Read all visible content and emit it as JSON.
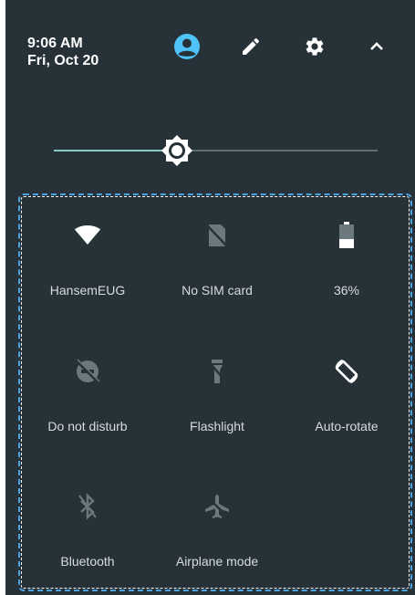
{
  "status": {
    "time": "9:06 AM",
    "date": "Fri, Oct 20"
  },
  "header_icons": [
    "account-icon",
    "edit-icon",
    "settings-icon",
    "collapse-icon"
  ],
  "colors": {
    "panel_bg": "#263238",
    "accent": "#80cbc4",
    "account_icon": "#4fc3f7",
    "active_icon": "#ffffff",
    "inactive_icon": "#6b787e",
    "selection_outline": "#4aa3df"
  },
  "brightness": {
    "level": 0.37
  },
  "tiles": [
    {
      "label": "HansemEUG",
      "icon": "wifi-icon",
      "active": true
    },
    {
      "label": "No SIM card",
      "icon": "no-sim-icon",
      "active": false
    },
    {
      "label": "36%",
      "icon": "battery-icon",
      "active": true
    },
    {
      "label": "Do not disturb",
      "icon": "do-not-disturb-icon",
      "active": false
    },
    {
      "label": "Flashlight",
      "icon": "flashlight-icon",
      "active": false
    },
    {
      "label": "Auto-rotate",
      "icon": "auto-rotate-icon",
      "active": true
    },
    {
      "label": "Bluetooth",
      "icon": "bluetooth-icon",
      "active": false
    },
    {
      "label": "Airplane mode",
      "icon": "airplane-icon",
      "active": false
    }
  ]
}
